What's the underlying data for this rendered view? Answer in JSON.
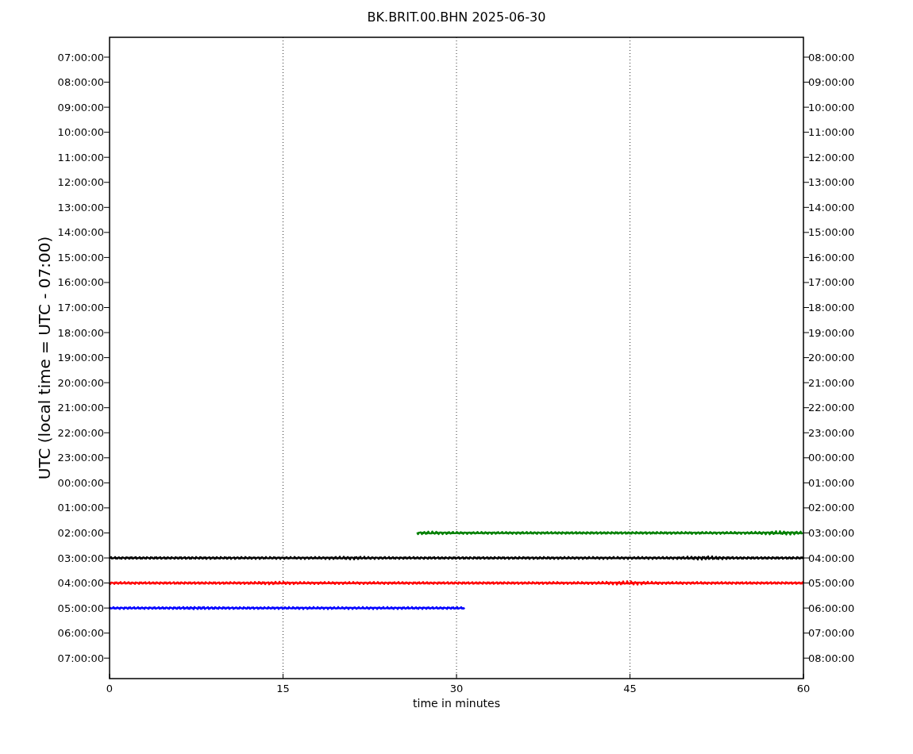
{
  "plot": {
    "title": "BK.BRIT.00.BHN 2025-06-30",
    "xlabel": "time in minutes",
    "ylabel": "UTC (local time = UTC - 07:00)",
    "x_tick_labels": [
      "0",
      "15",
      "30",
      "45",
      "60"
    ],
    "left_tick_labels": [
      "07:00:00",
      "08:00:00",
      "09:00:00",
      "10:00:00",
      "11:00:00",
      "12:00:00",
      "13:00:00",
      "14:00:00",
      "15:00:00",
      "16:00:00",
      "17:00:00",
      "18:00:00",
      "19:00:00",
      "20:00:00",
      "21:00:00",
      "22:00:00",
      "23:00:00",
      "00:00:00",
      "01:00:00",
      "02:00:00",
      "03:00:00",
      "04:00:00",
      "05:00:00",
      "06:00:00",
      "07:00:00"
    ],
    "right_tick_labels": [
      "08:00:00",
      "09:00:00",
      "10:00:00",
      "11:00:00",
      "12:00:00",
      "13:00:00",
      "14:00:00",
      "15:00:00",
      "16:00:00",
      "17:00:00",
      "18:00:00",
      "19:00:00",
      "20:00:00",
      "21:00:00",
      "22:00:00",
      "23:00:00",
      "00:00:00",
      "01:00:00",
      "02:00:00",
      "03:00:00",
      "04:00:00",
      "05:00:00",
      "06:00:00",
      "07:00:00",
      "08:00:00"
    ]
  }
}
